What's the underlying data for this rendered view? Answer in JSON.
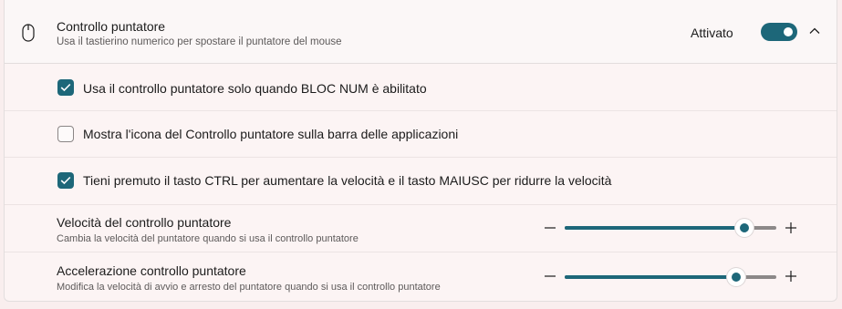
{
  "header": {
    "icon": "mouse-icon",
    "title": "Controllo puntatore",
    "description": "Usa il tastierino numerico per spostare il puntatore del mouse",
    "toggle_label": "Attivato",
    "toggle_on": true,
    "expand_icon": "chevron-up-icon"
  },
  "options": [
    {
      "label": "Usa il controllo puntatore solo quando BLOC NUM è abilitato",
      "checked": true
    },
    {
      "label": "Mostra l'icona del Controllo puntatore sulla barra delle applicazioni",
      "checked": false
    },
    {
      "label": "Tieni premuto il tasto CTRL per aumentare la velocità e il tasto MAIUSC per ridurre la velocità",
      "checked": true
    }
  ],
  "sliders": [
    {
      "title": "Velocità del controllo puntatore",
      "description": "Cambia la velocità del puntatore quando si usa il controllo puntatore",
      "value_fraction": 0.85
    },
    {
      "title": "Accelerazione controllo puntatore",
      "description": "Modifica la velocità di avvio e arresto del puntatore quando si usa il controllo puntatore",
      "value_fraction": 0.81
    }
  ],
  "colors": {
    "accent": "#1d6779",
    "background": "#f9eeee"
  }
}
